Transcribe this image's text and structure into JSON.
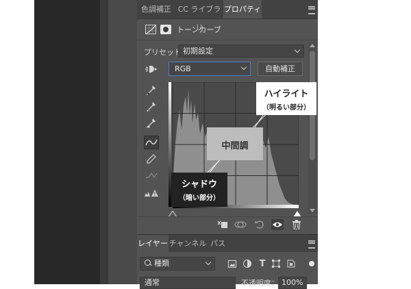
{
  "tabs": [
    {
      "label": "色調補正",
      "active": false
    },
    {
      "label": "CC ライブラリ",
      "active": false
    },
    {
      "label": "プロパティ",
      "active": true
    }
  ],
  "properties": {
    "title": "トーンカーブ",
    "preset_label": "プリセット：",
    "preset_value": "初期設定",
    "channel_value": "RGB",
    "auto_button": "自動補正"
  },
  "callouts": {
    "highlight": {
      "title": "ハイライト",
      "sub": "（明るい部分）"
    },
    "midtone": {
      "title": "中間調"
    },
    "shadow": {
      "title": "シャドウ",
      "sub": "（暗い部分）"
    }
  },
  "layers": {
    "tabs": [
      {
        "label": "レイヤー",
        "active": true
      },
      {
        "label": "チャンネル",
        "active": false
      },
      {
        "label": "パス",
        "active": false
      }
    ],
    "kind_label": "種類",
    "blend_mode": "通常",
    "opacity_label": "不透明度：",
    "opacity_value": "100%"
  },
  "colors": {
    "panel_bg": "#535353",
    "dark_bg": "#282828",
    "accent_blue": "#4c7ed0"
  },
  "icons": {
    "tools": [
      "eyedropper-black-icon",
      "eyedropper-gray-icon",
      "eyedropper-white-icon",
      "curve-point-icon",
      "pencil-icon",
      "smooth-icon",
      "clipping-warning-icon"
    ],
    "bottom": [
      "clip-to-layer-icon",
      "view-previous-icon",
      "reset-icon",
      "visibility-eye-icon",
      "trash-icon"
    ]
  }
}
